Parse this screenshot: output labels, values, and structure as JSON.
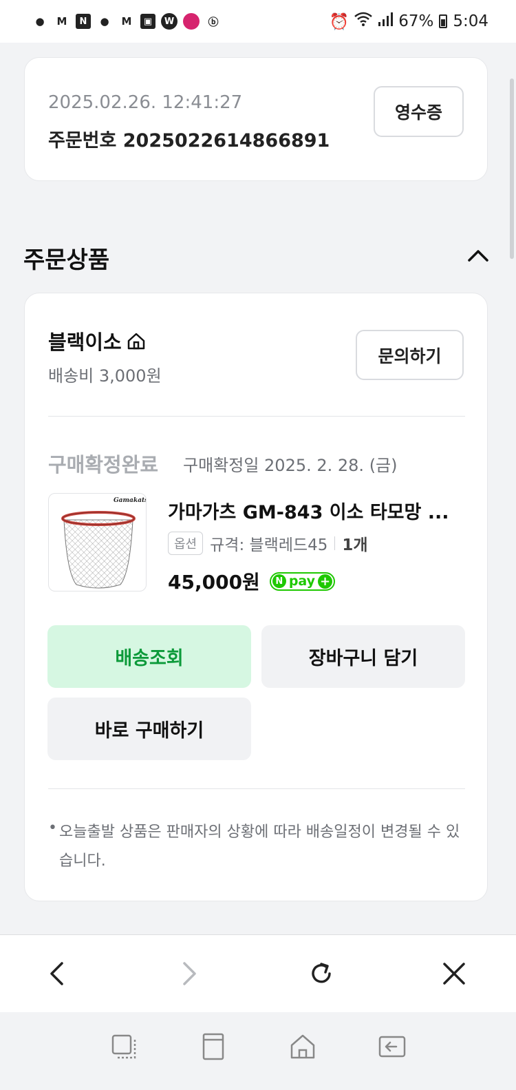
{
  "status_bar": {
    "battery": "67%",
    "time": "5:04"
  },
  "order": {
    "date": "2025.02.26. 12:41:27",
    "number_label": "주문번호 2025022614866891",
    "receipt_button": "영수증"
  },
  "section": {
    "title": "주문상품"
  },
  "shop": {
    "name": "블랙이소",
    "shipping_fee": "배송비 3,000원",
    "inquiry_button": "문의하기"
  },
  "item": {
    "status": "구매확정완료",
    "confirm_date": "구매확정일 2025. 2. 28. (금)",
    "name": "가마가츠 GM-843 이소 타모망 ...",
    "option_tag": "옵션",
    "option_value": "규격: 블랙레드45",
    "quantity": "1개",
    "price": "45,000원",
    "npay_label": "pay",
    "brand_mark": "Gamakatsu"
  },
  "actions": {
    "track": "배송조회",
    "cart": "장바구니 담기",
    "buy": "바로 구매하기"
  },
  "note": {
    "text": "오늘출발 상품은 판매자의 상황에 따라 배송일정이 변경될 수 있습니다."
  },
  "colors": {
    "accent_green": "#0c9a3a",
    "track_bg": "#d6f7e2",
    "npay_green": "#1ec800"
  }
}
